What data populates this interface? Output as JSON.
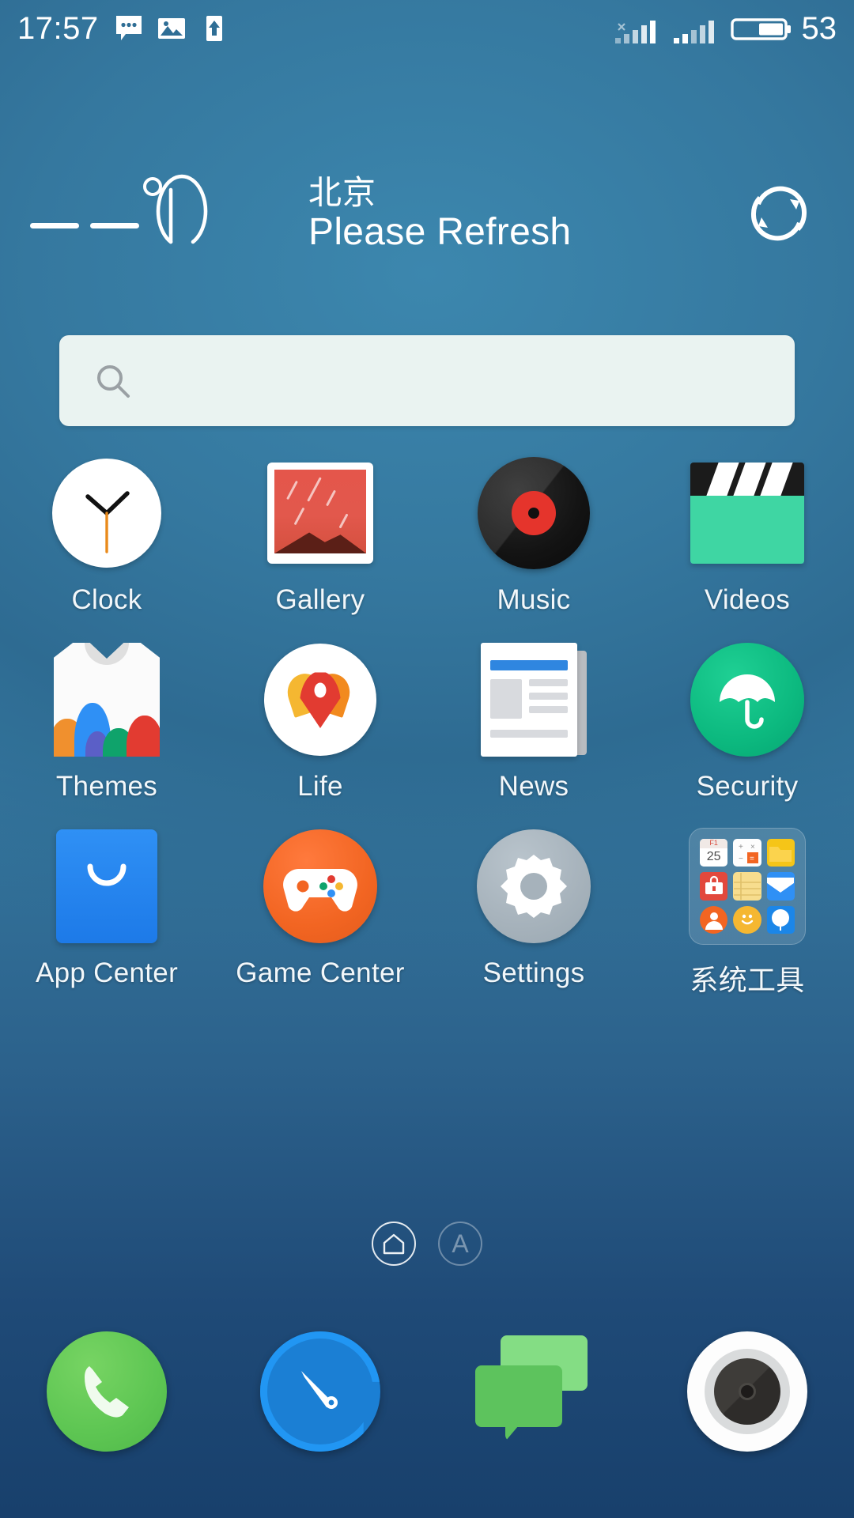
{
  "status_bar": {
    "time": "17:57",
    "battery_percent": "53",
    "notification_icons": [
      "sms-icon",
      "image-icon",
      "upload-icon"
    ],
    "signal_icons": [
      "signal-bars-no-service-icon",
      "signal-bars-icon"
    ],
    "battery_icon": "battery-icon"
  },
  "weather_widget": {
    "temperature": "--",
    "degree_unit": "°C",
    "city": "北京",
    "status": "Please Refresh",
    "refresh_icon": "refresh-icon"
  },
  "search": {
    "value": "",
    "placeholder": "",
    "icon": "search-icon"
  },
  "app_grid": {
    "rows": [
      [
        {
          "label": "Clock",
          "icon": "clock-icon"
        },
        {
          "label": "Gallery",
          "icon": "gallery-icon"
        },
        {
          "label": "Music",
          "icon": "music-icon"
        },
        {
          "label": "Videos",
          "icon": "videos-icon"
        }
      ],
      [
        {
          "label": "Themes",
          "icon": "themes-icon"
        },
        {
          "label": "Life",
          "icon": "life-icon"
        },
        {
          "label": "News",
          "icon": "news-icon"
        },
        {
          "label": "Security",
          "icon": "security-icon"
        }
      ],
      [
        {
          "label": "App Center",
          "icon": "app-center-icon"
        },
        {
          "label": "Game Center",
          "icon": "game-center-icon"
        },
        {
          "label": "Settings",
          "icon": "settings-icon"
        },
        {
          "label": "系统工具",
          "icon": "folder-icon"
        }
      ]
    ],
    "folder_contents": [
      "calendar-icon",
      "calculator-icon",
      "file-manager-icon",
      "toolbox-icon",
      "notes-icon",
      "email-icon",
      "contacts-icon",
      "emoji-icon",
      "weather-balloon-icon"
    ],
    "folder_calendar_day": "25"
  },
  "page_indicator": {
    "pages": [
      {
        "icon": "home-icon",
        "active": true
      },
      {
        "label": "A",
        "active": false
      }
    ]
  },
  "dock": {
    "items": [
      {
        "name": "Phone",
        "icon": "phone-icon"
      },
      {
        "name": "Browser",
        "icon": "browser-compass-icon"
      },
      {
        "name": "Messages",
        "icon": "messages-icon"
      },
      {
        "name": "Camera",
        "icon": "camera-icon"
      }
    ]
  },
  "colors": {
    "wallpaper_top": "#3a87ad",
    "wallpaper_bottom": "#18406c",
    "search_bg": "#eaf3f1",
    "accent_green": "#0cb97f",
    "accent_orange": "#f26522",
    "accent_blue": "#2f90f5",
    "text": "#ffffff"
  }
}
